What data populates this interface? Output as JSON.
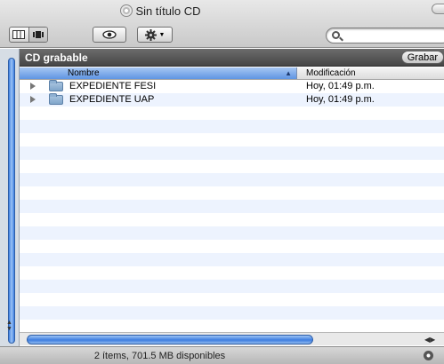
{
  "window": {
    "title": "Sin título CD",
    "title_icon": "cd-icon"
  },
  "toolbar": {
    "view_buttons": [
      "column-view-icon",
      "coverflow-view-icon"
    ],
    "quicklook_icon": "eye-icon",
    "action_icon": "gear-icon",
    "search_value": ""
  },
  "pathbar": {
    "title": "CD grabable",
    "burn_label": "Grabar"
  },
  "columns": {
    "name": "Nombre",
    "modified": "Modificación",
    "sort": "ascending"
  },
  "files": [
    {
      "name": "EXPEDIENTE FESI",
      "modified": "Hoy, 01:49 p.m.",
      "icon": "folder-icon"
    },
    {
      "name": "EXPEDIENTE UAP",
      "modified": "Hoy, 01:49 p.m.",
      "icon": "folder-icon"
    }
  ],
  "status": {
    "text": "2 ítems, 701.5 MB disponibles"
  },
  "colors": {
    "header_selected": "#5f95e3",
    "stripe": "#edf3fe",
    "pathbar": "#464646"
  }
}
